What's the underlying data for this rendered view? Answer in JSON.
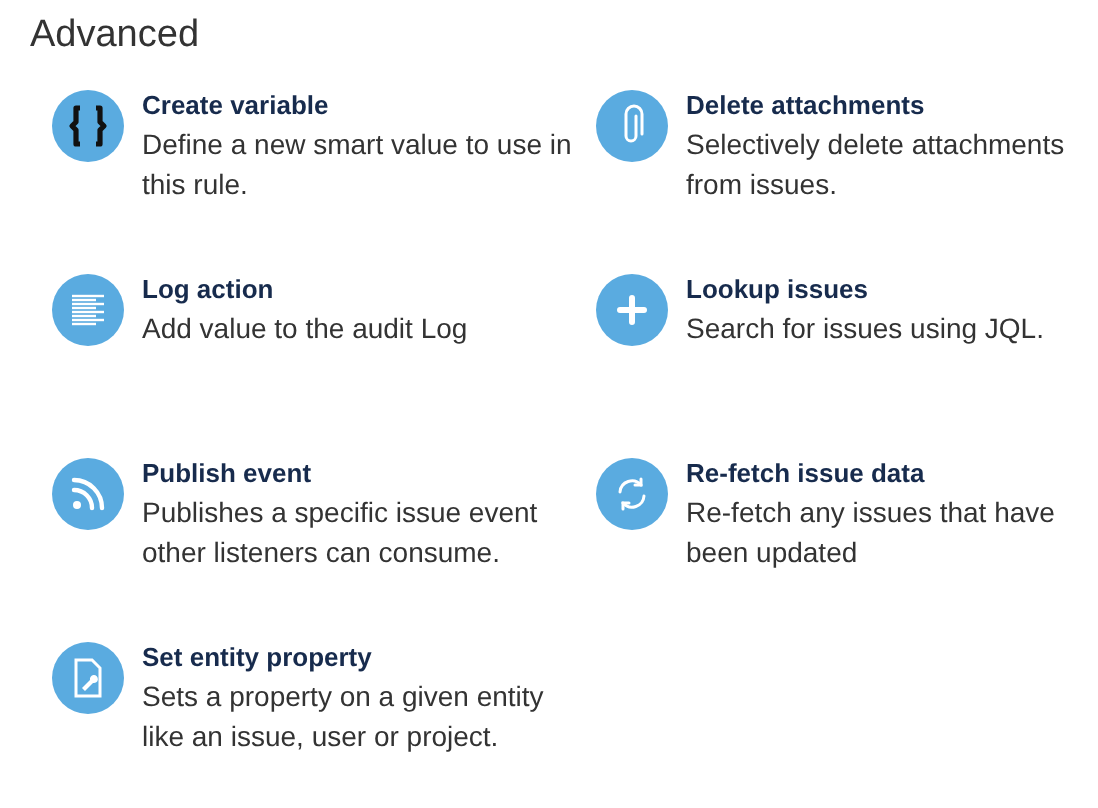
{
  "section": {
    "title": "Advanced"
  },
  "actions": [
    {
      "kind": "braces",
      "title": "Create variable",
      "description": "Define a new smart value to use in this rule."
    },
    {
      "kind": "paperclip",
      "title": "Delete attachments",
      "description": "Selectively delete attachments from issues."
    },
    {
      "kind": "log",
      "title": "Log action",
      "description": "Add value to the audit Log"
    },
    {
      "kind": "plus",
      "title": "Lookup issues",
      "description": "Search for issues using JQL."
    },
    {
      "kind": "feed",
      "title": "Publish event",
      "description": "Publishes a specific issue event other listeners can consume."
    },
    {
      "kind": "refresh",
      "title": "Re-fetch issue data",
      "description": "Re-fetch any issues that have been updated"
    },
    {
      "kind": "document",
      "title": "Set entity property",
      "description": "Sets a property on a given entity like an issue, user or project."
    }
  ]
}
